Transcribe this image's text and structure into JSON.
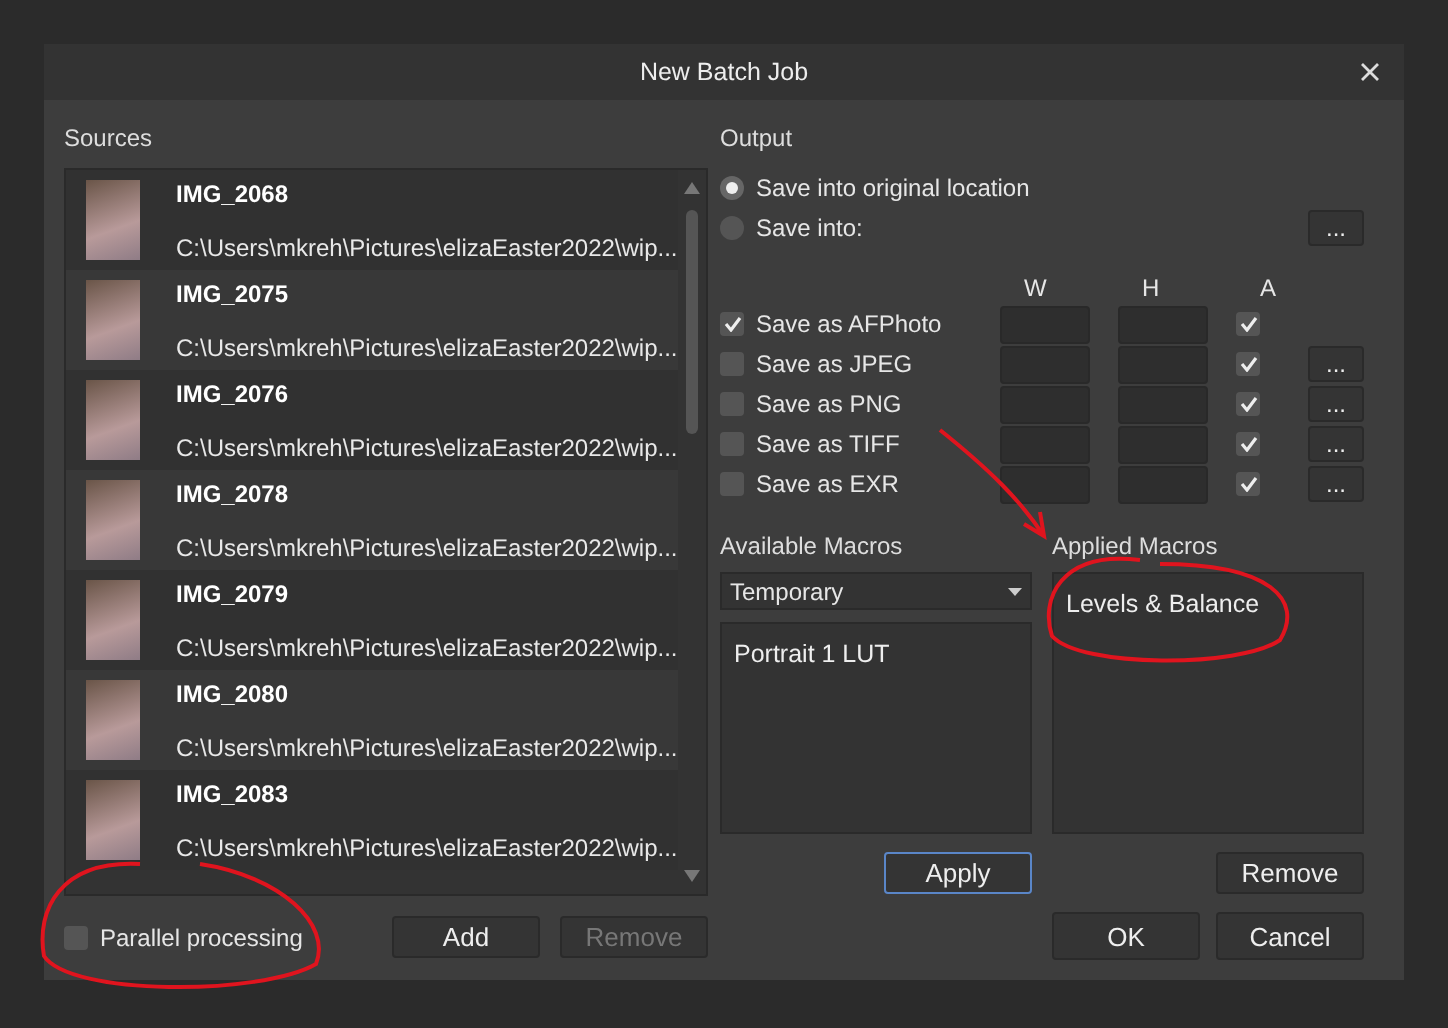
{
  "window": {
    "title": "New Batch Job"
  },
  "sources": {
    "label": "Sources",
    "items": [
      {
        "name": "IMG_2068",
        "path": "C:\\Users\\mkreh\\Pictures\\elizaEaster2022\\wip..."
      },
      {
        "name": "IMG_2075",
        "path": "C:\\Users\\mkreh\\Pictures\\elizaEaster2022\\wip..."
      },
      {
        "name": "IMG_2076",
        "path": "C:\\Users\\mkreh\\Pictures\\elizaEaster2022\\wip..."
      },
      {
        "name": "IMG_2078",
        "path": "C:\\Users\\mkreh\\Pictures\\elizaEaster2022\\wip..."
      },
      {
        "name": "IMG_2079",
        "path": "C:\\Users\\mkreh\\Pictures\\elizaEaster2022\\wip..."
      },
      {
        "name": "IMG_2080",
        "path": "C:\\Users\\mkreh\\Pictures\\elizaEaster2022\\wip..."
      },
      {
        "name": "IMG_2083",
        "path": "C:\\Users\\mkreh\\Pictures\\elizaEaster2022\\wip..."
      }
    ],
    "parallel_processing": {
      "label": "Parallel processing",
      "checked": false
    },
    "buttons": [
      {
        "label": "Add",
        "disabled": false
      },
      {
        "label": "Remove",
        "disabled": true
      }
    ]
  },
  "output": {
    "label": "Output",
    "destinations": [
      {
        "label": "Save into original location",
        "selected": true
      },
      {
        "label": "Save into:",
        "selected": false,
        "browse": "..."
      }
    ],
    "columns": [
      "W",
      "H",
      "A"
    ],
    "formats": [
      {
        "label": "Save as AFPhoto",
        "checked": true,
        "alpha": true
      },
      {
        "label": "Save as JPEG",
        "checked": false,
        "alpha": true,
        "options": "..."
      },
      {
        "label": "Save as PNG",
        "checked": false,
        "alpha": true,
        "options": "..."
      },
      {
        "label": "Save as TIFF",
        "checked": false,
        "alpha": true,
        "options": "..."
      },
      {
        "label": "Save as EXR",
        "checked": false,
        "alpha": true,
        "options": "..."
      }
    ]
  },
  "macros": {
    "available_label": "Available Macros",
    "category": "Temporary",
    "available": [
      "Portrait 1 LUT"
    ],
    "applied_label": "Applied Macros",
    "applied": [
      "Levels & Balance"
    ],
    "apply": {
      "label": "Apply",
      "focused": true
    },
    "remove": {
      "label": "Remove",
      "focused": false
    }
  },
  "footer": [
    {
      "label": "OK"
    },
    {
      "label": "Cancel"
    }
  ]
}
